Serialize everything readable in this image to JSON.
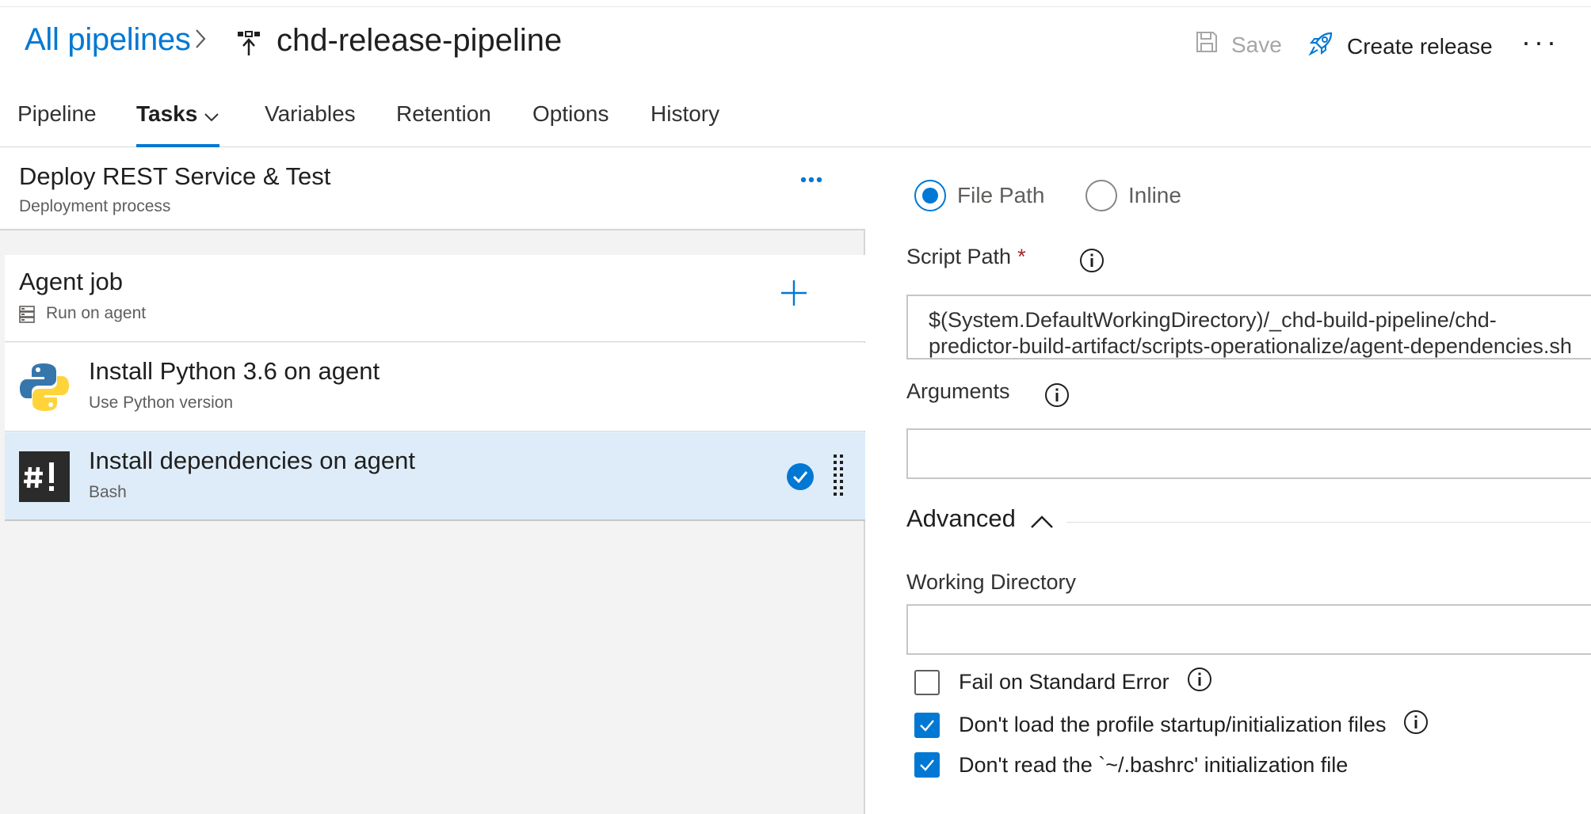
{
  "header": {
    "breadcrumb_link": "All pipelines",
    "title": "chd-release-pipeline",
    "save_label": "Save",
    "create_release_label": "Create release",
    "more_label": "···"
  },
  "tabs": [
    {
      "label": "Pipeline"
    },
    {
      "label": "Tasks"
    },
    {
      "label": "Variables"
    },
    {
      "label": "Retention"
    },
    {
      "label": "Options"
    },
    {
      "label": "History"
    }
  ],
  "left": {
    "process": {
      "title": "Deploy REST Service & Test",
      "subtitle": "Deployment process"
    },
    "job": {
      "title": "Agent job",
      "subtitle": "Run on agent"
    },
    "tasks": [
      {
        "title": "Install Python 3.6 on agent",
        "subtitle": "Use Python version",
        "icon": "python-icon",
        "selected": false
      },
      {
        "title": "Install dependencies on agent",
        "subtitle": "Bash",
        "icon": "bash-icon",
        "selected": true
      }
    ]
  },
  "right": {
    "type_options": [
      {
        "label": "File Path",
        "selected": true
      },
      {
        "label": "Inline",
        "selected": false
      }
    ],
    "script_path": {
      "label": "Script Path",
      "required_mark": "*",
      "value_line1": "$(System.DefaultWorkingDirectory)/_chd-build-pipeline/chd-",
      "value_line2": "predictor-build-artifact/scripts-operationalize/agent-dependencies.sh"
    },
    "arguments": {
      "label": "Arguments",
      "value": ""
    },
    "advanced": {
      "label": "Advanced"
    },
    "working_directory": {
      "label": "Working Directory",
      "value": ""
    },
    "checkboxes": [
      {
        "label": "Fail on Standard Error",
        "checked": false,
        "has_info": true
      },
      {
        "label": "Don't load the profile startup/initialization files",
        "checked": true,
        "has_info": true
      },
      {
        "label": "Don't read the `~/.bashrc' initialization file",
        "checked": true,
        "has_info": false
      }
    ]
  },
  "colors": {
    "accent": "#0078d4",
    "selected_row": "#deecf9",
    "required": "#a4262c",
    "muted_text": "#605e5c"
  }
}
